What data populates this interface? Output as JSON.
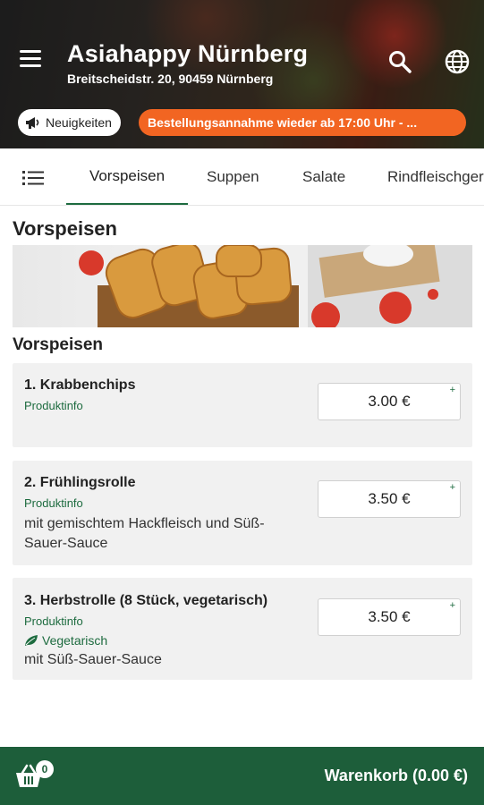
{
  "header": {
    "title": "Asiahappy Nürnberg",
    "address": "Breitscheidstr. 20, 90459 Nürnberg",
    "news_label": "Neuigkeiten",
    "notice": "Bestellungsannahme wieder ab 17:00 Uhr - ..."
  },
  "tabs": [
    {
      "label": "Vorspeisen"
    },
    {
      "label": "Suppen"
    },
    {
      "label": "Salate"
    },
    {
      "label": "Rindfleischgerichte"
    }
  ],
  "section": {
    "title": "Vorspeisen",
    "subtitle": "Vorspeisen"
  },
  "items": [
    {
      "name": "1. Krabbenchips",
      "info": "Produktinfo",
      "price": "3.00 €",
      "veg": "",
      "desc": ""
    },
    {
      "name": "2. Frühlingsrolle",
      "info": "Produktinfo",
      "price": "3.50 €",
      "veg": "",
      "desc": "mit gemischtem Hackfleisch und Süß-Sauer-Sauce"
    },
    {
      "name": "3. Herbstrolle (8 Stück, vegetarisch)",
      "info": "Produktinfo",
      "price": "3.50 €",
      "veg": "Vegetarisch",
      "desc": "mit Süß-Sauer-Sauce"
    }
  ],
  "cart": {
    "count": "0",
    "label": "Warenkorb (0.00 €)"
  },
  "colors": {
    "accent_green": "#1d6b3f",
    "bottom_bar": "#1d5e3a",
    "notice_orange": "#f26522"
  }
}
